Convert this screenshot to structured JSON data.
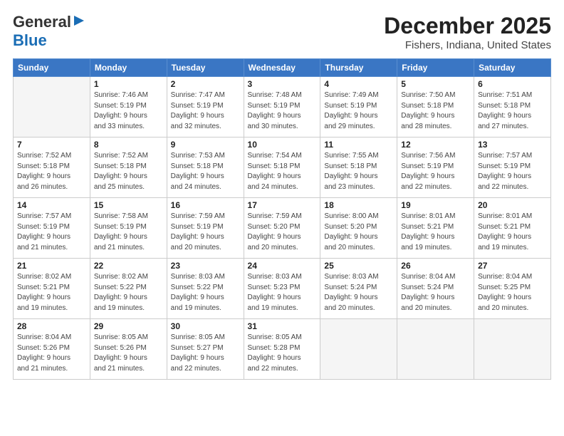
{
  "logo": {
    "part1": "General",
    "part2": "Blue"
  },
  "header": {
    "month": "December 2025",
    "location": "Fishers, Indiana, United States"
  },
  "days_of_week": [
    "Sunday",
    "Monday",
    "Tuesday",
    "Wednesday",
    "Thursday",
    "Friday",
    "Saturday"
  ],
  "weeks": [
    [
      {
        "day": "",
        "info": ""
      },
      {
        "day": "1",
        "info": "Sunrise: 7:46 AM\nSunset: 5:19 PM\nDaylight: 9 hours\nand 33 minutes."
      },
      {
        "day": "2",
        "info": "Sunrise: 7:47 AM\nSunset: 5:19 PM\nDaylight: 9 hours\nand 32 minutes."
      },
      {
        "day": "3",
        "info": "Sunrise: 7:48 AM\nSunset: 5:19 PM\nDaylight: 9 hours\nand 30 minutes."
      },
      {
        "day": "4",
        "info": "Sunrise: 7:49 AM\nSunset: 5:19 PM\nDaylight: 9 hours\nand 29 minutes."
      },
      {
        "day": "5",
        "info": "Sunrise: 7:50 AM\nSunset: 5:18 PM\nDaylight: 9 hours\nand 28 minutes."
      },
      {
        "day": "6",
        "info": "Sunrise: 7:51 AM\nSunset: 5:18 PM\nDaylight: 9 hours\nand 27 minutes."
      }
    ],
    [
      {
        "day": "7",
        "info": "Sunrise: 7:52 AM\nSunset: 5:18 PM\nDaylight: 9 hours\nand 26 minutes."
      },
      {
        "day": "8",
        "info": "Sunrise: 7:52 AM\nSunset: 5:18 PM\nDaylight: 9 hours\nand 25 minutes."
      },
      {
        "day": "9",
        "info": "Sunrise: 7:53 AM\nSunset: 5:18 PM\nDaylight: 9 hours\nand 24 minutes."
      },
      {
        "day": "10",
        "info": "Sunrise: 7:54 AM\nSunset: 5:18 PM\nDaylight: 9 hours\nand 24 minutes."
      },
      {
        "day": "11",
        "info": "Sunrise: 7:55 AM\nSunset: 5:18 PM\nDaylight: 9 hours\nand 23 minutes."
      },
      {
        "day": "12",
        "info": "Sunrise: 7:56 AM\nSunset: 5:19 PM\nDaylight: 9 hours\nand 22 minutes."
      },
      {
        "day": "13",
        "info": "Sunrise: 7:57 AM\nSunset: 5:19 PM\nDaylight: 9 hours\nand 22 minutes."
      }
    ],
    [
      {
        "day": "14",
        "info": "Sunrise: 7:57 AM\nSunset: 5:19 PM\nDaylight: 9 hours\nand 21 minutes."
      },
      {
        "day": "15",
        "info": "Sunrise: 7:58 AM\nSunset: 5:19 PM\nDaylight: 9 hours\nand 21 minutes."
      },
      {
        "day": "16",
        "info": "Sunrise: 7:59 AM\nSunset: 5:19 PM\nDaylight: 9 hours\nand 20 minutes."
      },
      {
        "day": "17",
        "info": "Sunrise: 7:59 AM\nSunset: 5:20 PM\nDaylight: 9 hours\nand 20 minutes."
      },
      {
        "day": "18",
        "info": "Sunrise: 8:00 AM\nSunset: 5:20 PM\nDaylight: 9 hours\nand 20 minutes."
      },
      {
        "day": "19",
        "info": "Sunrise: 8:01 AM\nSunset: 5:21 PM\nDaylight: 9 hours\nand 19 minutes."
      },
      {
        "day": "20",
        "info": "Sunrise: 8:01 AM\nSunset: 5:21 PM\nDaylight: 9 hours\nand 19 minutes."
      }
    ],
    [
      {
        "day": "21",
        "info": "Sunrise: 8:02 AM\nSunset: 5:21 PM\nDaylight: 9 hours\nand 19 minutes."
      },
      {
        "day": "22",
        "info": "Sunrise: 8:02 AM\nSunset: 5:22 PM\nDaylight: 9 hours\nand 19 minutes."
      },
      {
        "day": "23",
        "info": "Sunrise: 8:03 AM\nSunset: 5:22 PM\nDaylight: 9 hours\nand 19 minutes."
      },
      {
        "day": "24",
        "info": "Sunrise: 8:03 AM\nSunset: 5:23 PM\nDaylight: 9 hours\nand 19 minutes."
      },
      {
        "day": "25",
        "info": "Sunrise: 8:03 AM\nSunset: 5:24 PM\nDaylight: 9 hours\nand 20 minutes."
      },
      {
        "day": "26",
        "info": "Sunrise: 8:04 AM\nSunset: 5:24 PM\nDaylight: 9 hours\nand 20 minutes."
      },
      {
        "day": "27",
        "info": "Sunrise: 8:04 AM\nSunset: 5:25 PM\nDaylight: 9 hours\nand 20 minutes."
      }
    ],
    [
      {
        "day": "28",
        "info": "Sunrise: 8:04 AM\nSunset: 5:26 PM\nDaylight: 9 hours\nand 21 minutes."
      },
      {
        "day": "29",
        "info": "Sunrise: 8:05 AM\nSunset: 5:26 PM\nDaylight: 9 hours\nand 21 minutes."
      },
      {
        "day": "30",
        "info": "Sunrise: 8:05 AM\nSunset: 5:27 PM\nDaylight: 9 hours\nand 22 minutes."
      },
      {
        "day": "31",
        "info": "Sunrise: 8:05 AM\nSunset: 5:28 PM\nDaylight: 9 hours\nand 22 minutes."
      },
      {
        "day": "",
        "info": ""
      },
      {
        "day": "",
        "info": ""
      },
      {
        "day": "",
        "info": ""
      }
    ]
  ]
}
